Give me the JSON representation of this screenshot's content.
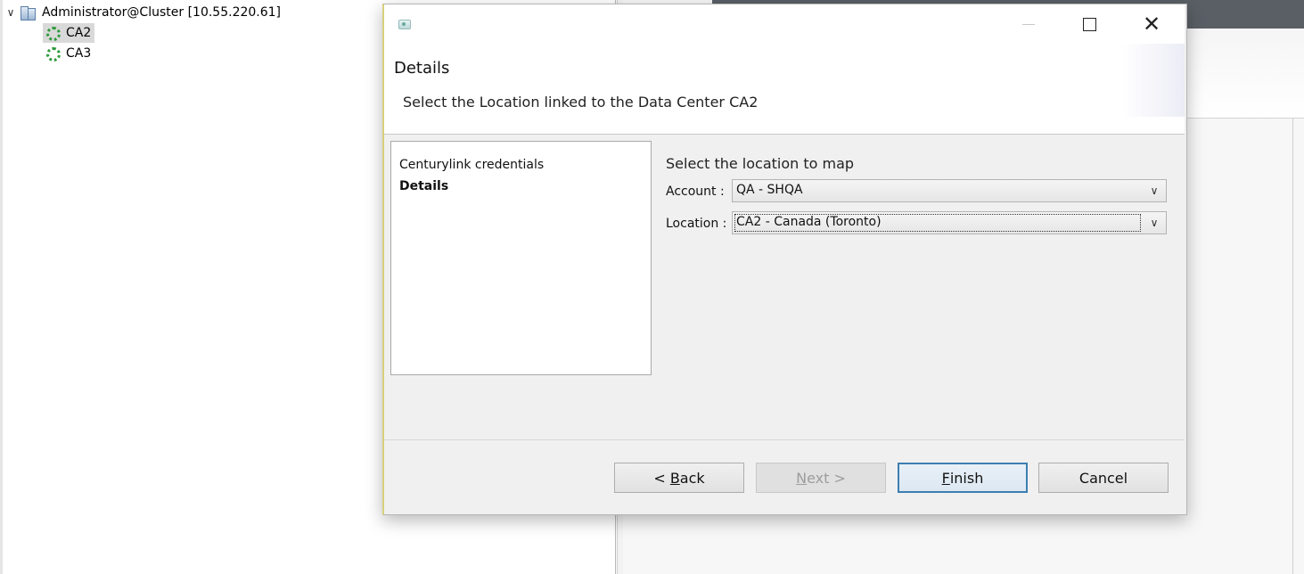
{
  "tree": {
    "root_label": "Administrator@Cluster [10.55.220.61]",
    "children": [
      {
        "label": "CA2",
        "selected": true
      },
      {
        "label": "CA3",
        "selected": false
      }
    ]
  },
  "dialog": {
    "title_icon": "app-icon",
    "controls": {
      "minimize": "minimize-icon",
      "maximize": "maximize-icon",
      "close": "✕"
    },
    "header": {
      "title": "Details",
      "subtitle": "Select the Location linked to the Data Center CA2"
    },
    "steps": [
      {
        "label": "Centurylink credentials",
        "active": false
      },
      {
        "label": "Details",
        "active": true
      }
    ],
    "content": {
      "title": "Select the location to map",
      "account_label": "Account :",
      "account_value": "QA - SHQA",
      "location_label": "Location :",
      "location_value": "CA2 - Canada (Toronto)",
      "dropdown_arrow": "∨"
    },
    "buttons": {
      "back_prefix": "< ",
      "back_mnemonic": "B",
      "back_rest": "ack",
      "next_mnemonic": "N",
      "next_rest": "ext >",
      "finish_mnemonic": "F",
      "finish_rest": "inish",
      "cancel": "Cancel"
    }
  }
}
